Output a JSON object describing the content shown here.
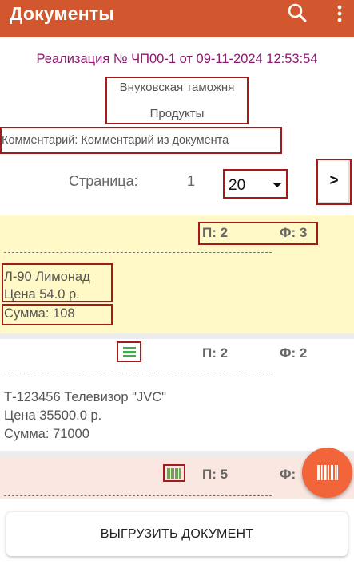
{
  "appbar": {
    "title": "Документы",
    "search_icon": "search-icon",
    "more_icon": "more-vertical-icon",
    "color": "#d3572e"
  },
  "document": {
    "title": "Реализация № ЧП00-1 от 09-11-2024 12:53:54",
    "organization": "Внуковская таможня",
    "warehouse": "Продукты",
    "comment": "Комментарий: Комментарий из документа"
  },
  "pagination": {
    "label": "Страница:",
    "page": "1",
    "page_size": "20",
    "next_label": ">"
  },
  "items": [
    {
      "plan": "П: 2",
      "fact": "Ф: 3",
      "name": "Л-90 Лимонад",
      "price": "Цена 54.0 р.",
      "sum": "Сумма: 108",
      "background": "#fff8c7"
    },
    {
      "plan": "П: 2",
      "fact": "Ф: 2",
      "name": "Т-123456 Телевизор \"JVC\"",
      "price": "Цена 35500.0 р.",
      "sum": "Сумма: 71000",
      "icon": "list-icon",
      "background": "#ffffff"
    },
    {
      "plan": "П: 5",
      "fact": "Ф:",
      "icon": "barcode-icon",
      "background": "#fbe7e2"
    }
  ],
  "fab": {
    "icon": "barcode-scan-icon",
    "color": "#f2643a"
  },
  "export_button": {
    "label": "ВЫГРУЗИТЬ ДОКУМЕНТ"
  }
}
